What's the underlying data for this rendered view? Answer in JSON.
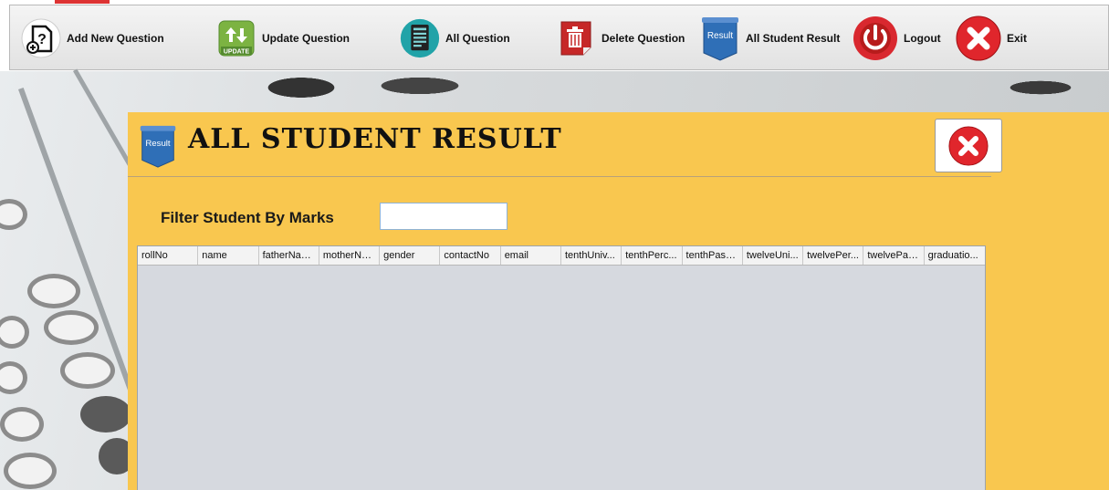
{
  "toolbar": {
    "items": [
      {
        "label": "Add New Question",
        "icon": "add-question-icon"
      },
      {
        "label": "Update Question",
        "icon": "update-icon"
      },
      {
        "label": "All Question",
        "icon": "document-list-icon"
      },
      {
        "label": "Delete Question",
        "icon": "trash-icon"
      },
      {
        "label": "All Student Result",
        "icon": "result-badge-icon"
      },
      {
        "label": "Logout",
        "icon": "power-icon"
      },
      {
        "label": "Exit",
        "icon": "close-icon"
      }
    ],
    "update_badge_text": "UPDATE",
    "result_badge_text": "Result"
  },
  "panel": {
    "title": "ALL STUDENT RESULT",
    "badge_text": "Result",
    "filter_label": "Filter Student By Marks",
    "filter_value": ""
  },
  "table": {
    "columns": [
      "rollNo",
      "name",
      "fatherName",
      "motherNa...",
      "gender",
      "contactNo",
      "email",
      "tenthUniv...",
      "tenthPerc...",
      "tenthPass...",
      "twelveUni...",
      "twelvePer...",
      "twelvePas...",
      "graduatio..."
    ],
    "rows": []
  },
  "colors": {
    "panel": "#f9c74f",
    "table_bg": "#d6d9df",
    "exit_red": "#e0262c",
    "logout_red": "#d9282f",
    "result_blue": "#2f6fb7"
  }
}
